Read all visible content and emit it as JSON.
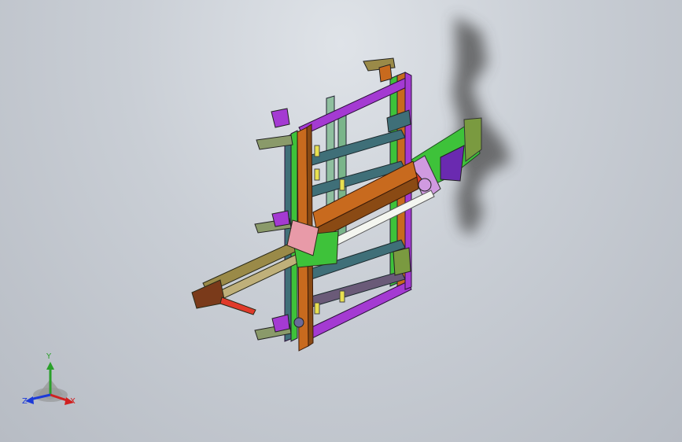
{
  "viewport": {
    "background_top": "#dfe3e8",
    "background_bottom": "#b7bcc4"
  },
  "model": {
    "description_icon": "cad-assembly-frame",
    "colors": {
      "purple": "#a43ad2",
      "orange": "#c86a1e",
      "green": "#3ec23a",
      "teal": "#3f6f78",
      "olive": "#9a8a48",
      "yellow": "#e8e050",
      "pink": "#e89aa8",
      "red": "#e03a2a",
      "shadow": "#5a5a5a"
    }
  },
  "triad": {
    "y_label": "Y",
    "x_label": "X",
    "z_label": "Z",
    "y_color": "#2aa02a",
    "x_color": "#d02020",
    "z_color": "#1c3ad8"
  }
}
